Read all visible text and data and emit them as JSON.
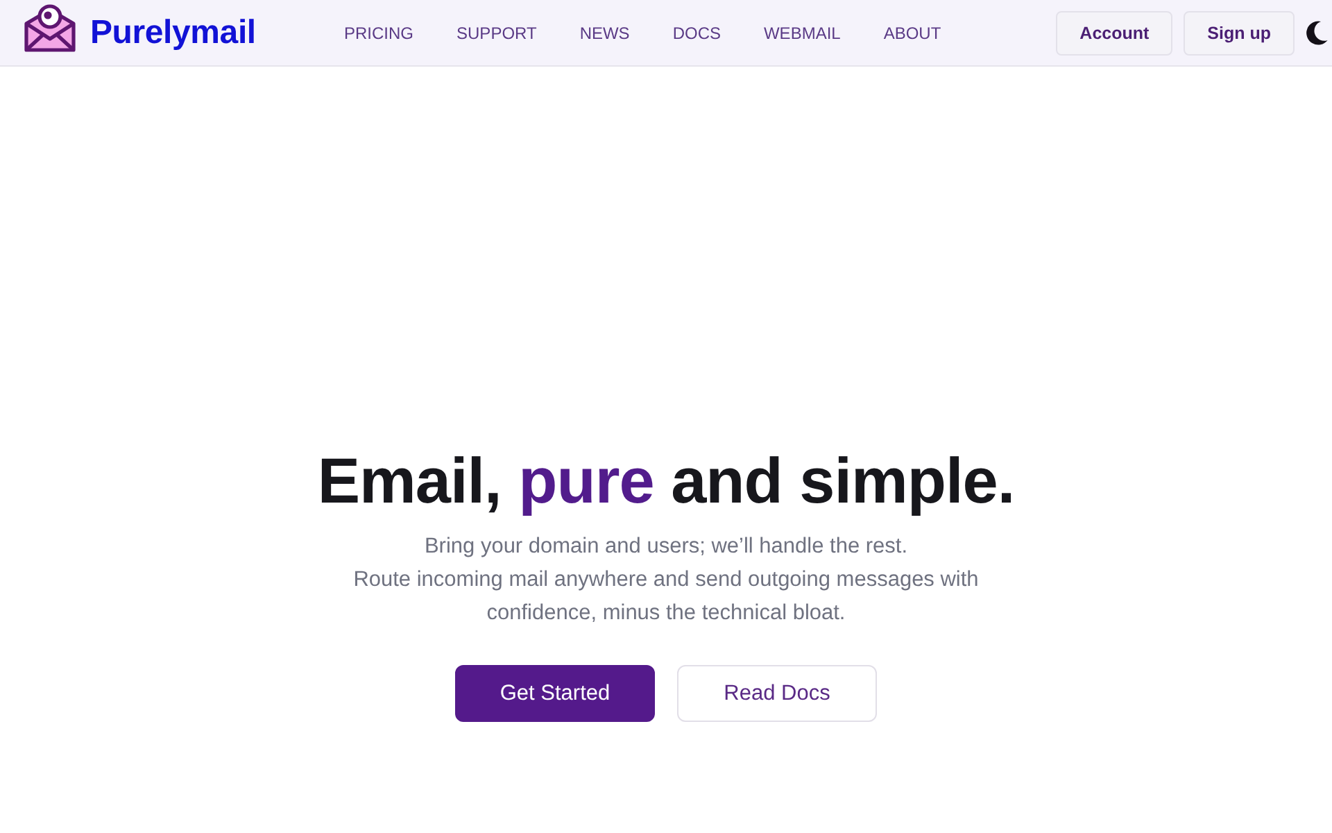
{
  "header": {
    "brand": "Purelymail",
    "nav": [
      "PRICING",
      "SUPPORT",
      "NEWS",
      "DOCS",
      "WEBMAIL",
      "ABOUT"
    ],
    "buttons": [
      "Account",
      "Sign up"
    ]
  },
  "hero": {
    "headline": "Email, **pure** and simple.",
    "subtitle": [
      "Bring your domain and users; we’ll handle the rest.",
      "Route incoming mail anywhere and send outgoing messages with confidence, minus the technical bloat."
    ],
    "actions": [
      {
        "label": "Get Started",
        "kind": "primary"
      },
      {
        "label": "Read Docs",
        "kind": "secondary"
      }
    ]
  }
}
